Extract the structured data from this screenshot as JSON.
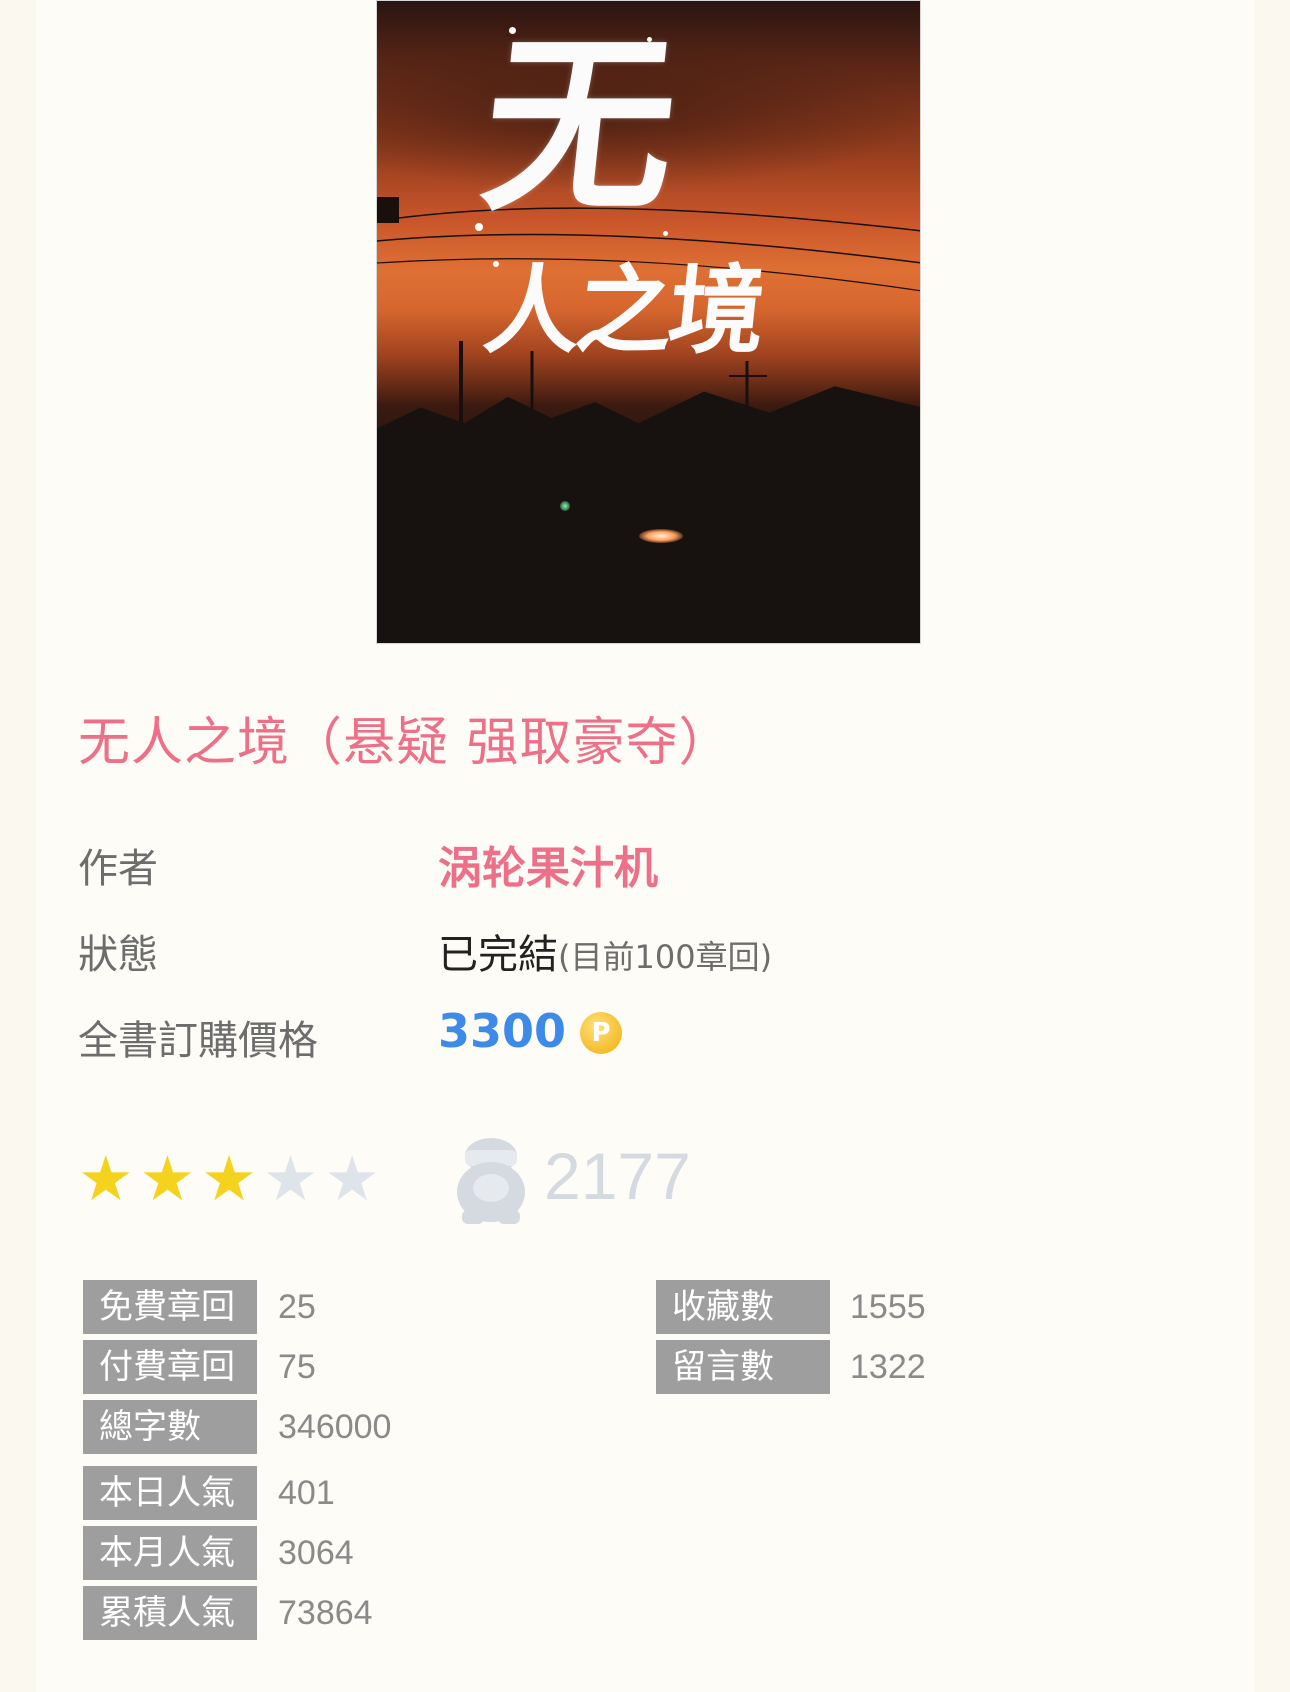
{
  "cover": {
    "title_big": "无",
    "title_sub": "人之境"
  },
  "book": {
    "title": "无人之境（悬疑 强取豪夺）"
  },
  "info": {
    "author_label": "作者",
    "author": "涡轮果汁机",
    "status_label": "狀態",
    "status": "已完結",
    "status_detail": "(目前100章回)",
    "price_label": "全書訂購價格",
    "price": "3300",
    "price_icon": "P"
  },
  "rating": {
    "stars": 3,
    "max_stars": 5,
    "fan_icon": "fan-figure-icon",
    "fans": "2177"
  },
  "stats": {
    "free_label": "免費章回",
    "free": "25",
    "paid_label": "付費章回",
    "paid": "75",
    "words_label": "總字數",
    "words": "346000",
    "collect_label": "收藏數",
    "collect": "1555",
    "comments_label": "留言數",
    "comments": "1322",
    "today_label": "本日人氣",
    "today": "401",
    "month_label": "本月人氣",
    "month": "3064",
    "total_label": "累積人氣",
    "total": "73864"
  },
  "colors": {
    "title_pink": "#ee6f88",
    "price_blue": "#3d8ae8",
    "star_on": "#f4d21d",
    "star_off": "#dfe4ea",
    "tag_gray": "#9e9e9e"
  }
}
